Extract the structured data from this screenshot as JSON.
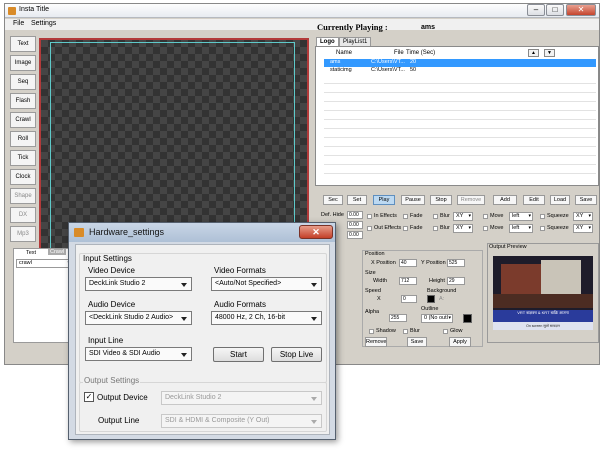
{
  "window": {
    "title": "Insta Title",
    "close_glyph": "✕",
    "min_glyph": "–",
    "max_glyph": "□"
  },
  "menu": [
    "File",
    "Settings"
  ],
  "sidebar": [
    "Text",
    "Image",
    "Seq",
    "Flash",
    "Crawl",
    "Roll",
    "Tick",
    "Clock",
    "Shape",
    "DX",
    "Mp3"
  ],
  "left_tabs": [
    "Text",
    "Crawl"
  ],
  "left_dropdown": "crawl",
  "currently_playing": {
    "label": "Currently Playing :",
    "value": "ams"
  },
  "playlist_tabs": [
    "Logo",
    "PlayList1"
  ],
  "playlist_headers": {
    "name": "Name",
    "file": "File",
    "time": "Time (Sec)"
  },
  "playlist_rows": [
    {
      "name": "ams",
      "file": "C:\\Users\\VT...",
      "time": "20"
    },
    {
      "name": "staticimg",
      "file": "C:\\Users\\VT...",
      "time": "50"
    }
  ],
  "control_buttons": [
    "Sec",
    "Set",
    "Play",
    "Pause",
    "Stop",
    "Remove",
    "Add",
    "Edit",
    "Load",
    "Save"
  ],
  "effects": {
    "def_hide": "Def. Hide",
    "in_effects": "In Effects",
    "out_effects": "Out Effects",
    "fade": "Fade",
    "blur": "Blur",
    "xy": "XY",
    "move": "Move",
    "left": "left",
    "squeeze": "Squeeze",
    "zero": "0.00"
  },
  "position": {
    "title": "Position",
    "x_label": "X Position",
    "x": "40",
    "y_label": "Y Position",
    "y": "525",
    "size_title": "Size",
    "width_label": "Width",
    "width": "712",
    "height_label": "Height",
    "height": "29",
    "speed_label": "Speed",
    "x_short": "X",
    "speed": "0",
    "background": "Background",
    "a_label": "A:",
    "alpha_label": "Alpha",
    "alpha": "255",
    "outline_label": "Outline",
    "outline": "0 (No outl",
    "shadow": "Shadow",
    "blur": "Blur",
    "glow": "Glow",
    "remove": "Remove",
    "save": "Save",
    "apply": "Apply"
  },
  "output_preview": {
    "label": "Output Preview",
    "banner": "VRT बाज्ञक्त्र & KRT बाक्रि आतना",
    "banner_sub": "On screen सुलो सावदान"
  },
  "dialog": {
    "title": "Hardware_settings",
    "close": "✕",
    "input_settings": "Input Settings",
    "video_device_label": "Video Device",
    "video_device": "DeckLink Studio 2",
    "video_formats_label": "Video Formats",
    "video_format": "<Auto/Not Specified>",
    "audio_device_label": "Audio Device",
    "audio_device": "<DeckLink Studio 2 Audio>",
    "audio_formats_label": "Audio Formats",
    "audio_format": "48000 Hz, 2 Ch, 16-bit",
    "input_line_label": "Input Line",
    "input_line": "SDI Video & SDI Audio",
    "start": "Start",
    "stop_live": "Stop Live",
    "output_settings": "Output Settings",
    "output_device_label": "Output Device",
    "output_device": "DeckLink Studio 2",
    "output_line_label": "Output Line",
    "output_line": "SDI & HDMI & Composite (Y Out)",
    "output_device_checked": true
  }
}
